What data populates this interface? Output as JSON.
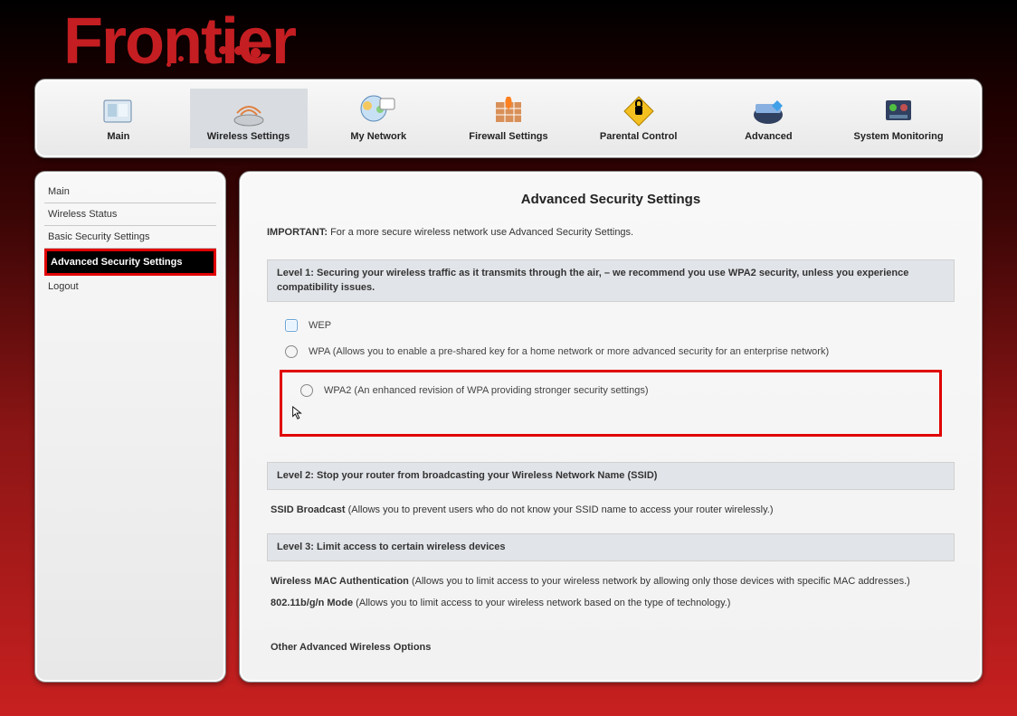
{
  "brand": "Frontier",
  "topnav": [
    {
      "label": "Main"
    },
    {
      "label": "Wireless Settings"
    },
    {
      "label": "My Network"
    },
    {
      "label": "Firewall Settings"
    },
    {
      "label": "Parental Control"
    },
    {
      "label": "Advanced"
    },
    {
      "label": "System Monitoring"
    }
  ],
  "sidebar": [
    {
      "label": "Main"
    },
    {
      "label": "Wireless Status"
    },
    {
      "label": "Basic Security Settings"
    },
    {
      "label": "Advanced Security Settings"
    },
    {
      "label": "Logout"
    }
  ],
  "page": {
    "title": "Advanced Security Settings",
    "important_label": "IMPORTANT:",
    "important_text": " For a more secure wireless network use Advanced Security Settings.",
    "level1_head": "Level 1: Securing your wireless traffic as it transmits through the air, – we recommend you use WPA2 security, unless you experience compatibility issues.",
    "opt_wep": "WEP",
    "opt_wpa": "WPA (Allows you to enable a pre-shared key for a home network or more advanced security for an enterprise network)",
    "opt_wpa2": "WPA2 (An enhanced revision of WPA providing stronger security settings)",
    "level2_head": "Level 2: Stop your router from broadcasting your Wireless Network Name (SSID)",
    "ssid_label": "SSID Broadcast",
    "ssid_text": " (Allows you to prevent users who do not know your SSID name to access your router wirelessly.)",
    "level3_head": "Level 3: Limit access to certain wireless devices",
    "mac_label": "Wireless MAC Authentication",
    "mac_text": " (Allows you to limit access to your wireless network by allowing only those devices with specific MAC addresses.)",
    "mode_label": "802.11b/g/n Mode",
    "mode_text": " (Allows you to limit access to your wireless network based on the type of technology.)",
    "other": "Other Advanced Wireless Options"
  }
}
